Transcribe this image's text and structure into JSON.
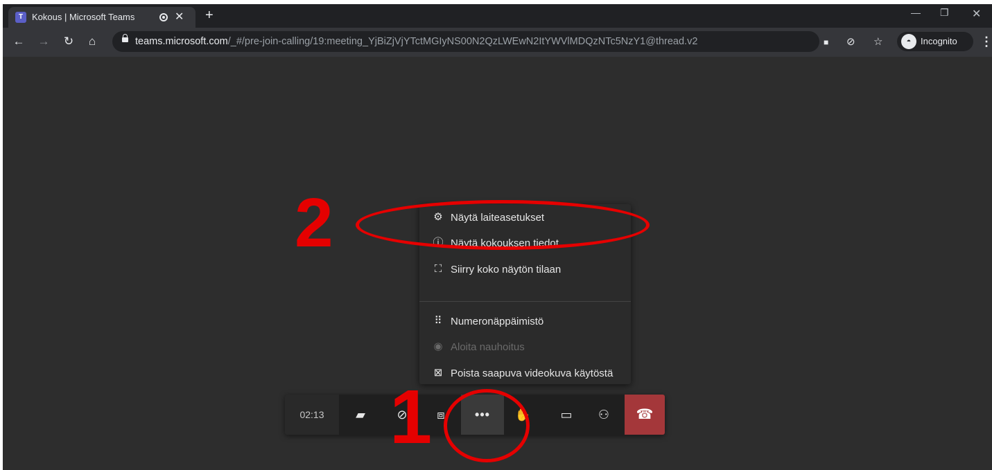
{
  "browser": {
    "tab_title": "Kokous | Microsoft Teams",
    "favicon_text": "T",
    "url_host": "teams.microsoft.com",
    "url_path": "/_#/pre-join-calling/19:meeting_YjBiZjVjYTctMGIyNS00N2QzLWEwN2ItYWVlMDQzNTc5NzY1@thread.v2",
    "incognito_label": "Incognito"
  },
  "menu": {
    "items": [
      {
        "label": "Näytä laiteasetukset",
        "icon": "gear-icon"
      },
      {
        "label": "Näytä kokouksen tiedot",
        "icon": "info-icon"
      },
      {
        "label": "Siirry koko näytön tilaan",
        "icon": "fullscreen-icon"
      },
      {
        "label": "Numeronäppäimistö",
        "icon": "dialpad-icon"
      },
      {
        "label": "Aloita nauhoitus",
        "icon": "record-icon",
        "disabled": true
      },
      {
        "label": "Poista saapuva videokuva käytöstä",
        "icon": "video-off-icon"
      }
    ]
  },
  "callbar": {
    "timer": "02:13",
    "buttons": [
      "camera-off-icon",
      "mic-off-icon",
      "share-screen-icon",
      "more-actions-icon",
      "raise-hand-icon",
      "chat-icon",
      "participants-icon",
      "hangup-icon"
    ]
  },
  "annotations": {
    "step1": "1",
    "step2": "2",
    "color": "#e50000"
  }
}
